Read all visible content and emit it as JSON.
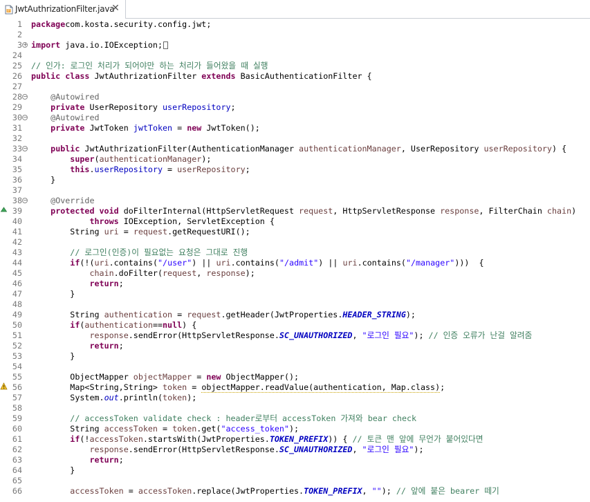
{
  "tab": {
    "title": "JwtAuthrizationFilter.java",
    "icon": "java-file-icon",
    "close": "✕"
  },
  "colors": {
    "keyword": "#7f0055",
    "comment": "#3f7f5f",
    "string": "#2a00ff",
    "field": "#0000c0",
    "parameter": "#6a3e3e",
    "annotation": "#646464",
    "line_number": "#787878"
  },
  "lines": [
    {
      "n": "1",
      "fold": "",
      "segs": [
        [
          "kw",
          "package"
        ],
        [
          "",
          "com.kosta.security.config.jwt;"
        ]
      ]
    },
    {
      "n": "2",
      "fold": "",
      "segs": []
    },
    {
      "n": "3",
      "fold": "+",
      "segs": [
        [
          "kw",
          "import"
        ],
        [
          "",
          " java.io.IOException;"
        ],
        [
          "box",
          ""
        ]
      ]
    },
    {
      "n": "24",
      "fold": "",
      "segs": []
    },
    {
      "n": "25",
      "fold": "",
      "segs": [
        [
          "cm",
          "// 인가: 로그인 처리가 되어야만 하는 처리가 들어왔을 때 실행"
        ]
      ]
    },
    {
      "n": "26",
      "fold": "",
      "segs": [
        [
          "kw",
          "public class"
        ],
        [
          "",
          " JwtAuthrizationFilter "
        ],
        [
          "kw",
          "extends"
        ],
        [
          "",
          " BasicAuthenticationFilter {"
        ]
      ]
    },
    {
      "n": "27",
      "fold": "",
      "segs": []
    },
    {
      "n": "28",
      "fold": "-",
      "segs": [
        [
          "",
          "    "
        ],
        [
          "ann",
          "@Autowired"
        ]
      ]
    },
    {
      "n": "29",
      "fold": "",
      "segs": [
        [
          "",
          "    "
        ],
        [
          "kw",
          "private"
        ],
        [
          "",
          " UserRepository "
        ],
        [
          "fld",
          "userRepository"
        ],
        [
          "",
          ";"
        ]
      ]
    },
    {
      "n": "30",
      "fold": "-",
      "segs": [
        [
          "",
          "    "
        ],
        [
          "ann",
          "@Autowired"
        ]
      ]
    },
    {
      "n": "31",
      "fold": "",
      "segs": [
        [
          "",
          "    "
        ],
        [
          "kw",
          "private"
        ],
        [
          "",
          " JwtToken "
        ],
        [
          "fld",
          "jwtToken"
        ],
        [
          "",
          " = "
        ],
        [
          "kw",
          "new"
        ],
        [
          "",
          " JwtToken();"
        ]
      ]
    },
    {
      "n": "32",
      "fold": "",
      "segs": []
    },
    {
      "n": "33",
      "fold": "-",
      "segs": [
        [
          "",
          "    "
        ],
        [
          "kw",
          "public"
        ],
        [
          "",
          " JwtAuthrizationFilter(AuthenticationManager "
        ],
        [
          "par",
          "authenticationManager"
        ],
        [
          "",
          ", UserRepository "
        ],
        [
          "par",
          "userRepository"
        ],
        [
          "",
          ") {"
        ]
      ]
    },
    {
      "n": "34",
      "fold": "",
      "segs": [
        [
          "",
          "        "
        ],
        [
          "kw",
          "super"
        ],
        [
          "",
          "("
        ],
        [
          "par",
          "authenticationManager"
        ],
        [
          "",
          ");"
        ]
      ]
    },
    {
      "n": "35",
      "fold": "",
      "segs": [
        [
          "",
          "        "
        ],
        [
          "kw",
          "this"
        ],
        [
          "",
          "."
        ],
        [
          "fld",
          "userRepository"
        ],
        [
          "",
          " = "
        ],
        [
          "par",
          "userRepository"
        ],
        [
          "",
          ";"
        ]
      ]
    },
    {
      "n": "36",
      "fold": "",
      "segs": [
        [
          "",
          "    }"
        ]
      ]
    },
    {
      "n": "37",
      "fold": "",
      "segs": []
    },
    {
      "n": "38",
      "fold": "-",
      "segs": [
        [
          "",
          "    "
        ],
        [
          "ann",
          "@Override"
        ]
      ]
    },
    {
      "n": "39",
      "fold": "",
      "segs": [
        [
          "",
          "    "
        ],
        [
          "kw",
          "protected void"
        ],
        [
          "",
          " doFilterInternal(HttpServletRequest "
        ],
        [
          "par",
          "request"
        ],
        [
          "",
          ", HttpServletResponse "
        ],
        [
          "par",
          "response"
        ],
        [
          "",
          ", FilterChain "
        ],
        [
          "par",
          "chain"
        ],
        [
          "",
          ")"
        ]
      ]
    },
    {
      "n": "40",
      "fold": "",
      "segs": [
        [
          "",
          "            "
        ],
        [
          "kw",
          "throws"
        ],
        [
          "",
          " IOException, ServletException {"
        ]
      ]
    },
    {
      "n": "41",
      "fold": "",
      "segs": [
        [
          "",
          "        String "
        ],
        [
          "par",
          "uri"
        ],
        [
          "",
          " = "
        ],
        [
          "par",
          "request"
        ],
        [
          "",
          ".getRequestURI();"
        ]
      ]
    },
    {
      "n": "42",
      "fold": "",
      "segs": []
    },
    {
      "n": "43",
      "fold": "",
      "segs": [
        [
          "",
          "        "
        ],
        [
          "cm",
          "// 로그인(인증)이 필요없는 요청은 그대로 진행"
        ]
      ]
    },
    {
      "n": "44",
      "fold": "",
      "segs": [
        [
          "",
          "        "
        ],
        [
          "kw",
          "if"
        ],
        [
          "",
          "(!("
        ],
        [
          "par",
          "uri"
        ],
        [
          "",
          ".contains("
        ],
        [
          "str",
          "\"/user\""
        ],
        [
          "",
          ") || "
        ],
        [
          "par",
          "uri"
        ],
        [
          "",
          ".contains("
        ],
        [
          "str",
          "\"/admit\""
        ],
        [
          "",
          ") || "
        ],
        [
          "par",
          "uri"
        ],
        [
          "",
          ".contains("
        ],
        [
          "str",
          "\"/manager\""
        ],
        [
          "",
          ")))  {"
        ]
      ]
    },
    {
      "n": "45",
      "fold": "",
      "segs": [
        [
          "",
          "            "
        ],
        [
          "par",
          "chain"
        ],
        [
          "",
          ".doFilter("
        ],
        [
          "par",
          "request"
        ],
        [
          "",
          ", "
        ],
        [
          "par",
          "response"
        ],
        [
          "",
          ");"
        ]
      ]
    },
    {
      "n": "46",
      "fold": "",
      "segs": [
        [
          "",
          "            "
        ],
        [
          "kw",
          "return"
        ],
        [
          "",
          ";"
        ]
      ]
    },
    {
      "n": "47",
      "fold": "",
      "segs": [
        [
          "",
          "        }"
        ]
      ]
    },
    {
      "n": "48",
      "fold": "",
      "segs": []
    },
    {
      "n": "49",
      "fold": "",
      "segs": [
        [
          "",
          "        String "
        ],
        [
          "par",
          "authentication"
        ],
        [
          "",
          " = "
        ],
        [
          "par",
          "request"
        ],
        [
          "",
          ".getHeader(JwtProperties."
        ],
        [
          "sfi",
          "HEADER_STRING"
        ],
        [
          "",
          ");"
        ]
      ]
    },
    {
      "n": "50",
      "fold": "",
      "segs": [
        [
          "",
          "        "
        ],
        [
          "kw",
          "if"
        ],
        [
          "",
          "("
        ],
        [
          "par",
          "authentication"
        ],
        [
          "",
          "=="
        ],
        [
          "kw",
          "null"
        ],
        [
          "",
          ") {"
        ]
      ]
    },
    {
      "n": "51",
      "fold": "",
      "segs": [
        [
          "",
          "            "
        ],
        [
          "par",
          "response"
        ],
        [
          "",
          ".sendError(HttpServletResponse."
        ],
        [
          "sfi",
          "SC_UNAUTHORIZED"
        ],
        [
          "",
          ", "
        ],
        [
          "str",
          "\"로그인 필요\""
        ],
        [
          "",
          "); "
        ],
        [
          "cm",
          "// 인증 오류가 난걸 알려줌"
        ]
      ]
    },
    {
      "n": "52",
      "fold": "",
      "segs": [
        [
          "",
          "            "
        ],
        [
          "kw",
          "return"
        ],
        [
          "",
          ";"
        ]
      ]
    },
    {
      "n": "53",
      "fold": "",
      "segs": [
        [
          "",
          "        }"
        ]
      ]
    },
    {
      "n": "54",
      "fold": "",
      "segs": []
    },
    {
      "n": "55",
      "fold": "",
      "segs": [
        [
          "",
          "        ObjectMapper "
        ],
        [
          "par",
          "objectMapper"
        ],
        [
          "",
          " = "
        ],
        [
          "kw",
          "new"
        ],
        [
          "",
          " ObjectMapper();"
        ]
      ]
    },
    {
      "n": "56",
      "fold": "",
      "segs": [
        [
          "",
          "        Map<String,String> "
        ],
        [
          "par",
          "token"
        ],
        [
          "",
          " = "
        ],
        [
          "warn",
          "objectMapper.readValue(authentication, Map.class)"
        ],
        [
          "",
          ";"
        ]
      ]
    },
    {
      "n": "57",
      "fold": "",
      "segs": [
        [
          "",
          "        System."
        ],
        [
          "sfn",
          "out"
        ],
        [
          "",
          ".println("
        ],
        [
          "par",
          "token"
        ],
        [
          "",
          ");"
        ]
      ]
    },
    {
      "n": "58",
      "fold": "",
      "segs": []
    },
    {
      "n": "59",
      "fold": "",
      "segs": [
        [
          "",
          "        "
        ],
        [
          "cm",
          "// accessToken validate check : header로부터 accessToken 가져와 bear check"
        ]
      ]
    },
    {
      "n": "60",
      "fold": "",
      "segs": [
        [
          "",
          "        String "
        ],
        [
          "par",
          "accessToken"
        ],
        [
          "",
          " = "
        ],
        [
          "par",
          "token"
        ],
        [
          "",
          ".get("
        ],
        [
          "str",
          "\"access_token\""
        ],
        [
          "",
          ");"
        ]
      ]
    },
    {
      "n": "61",
      "fold": "",
      "segs": [
        [
          "",
          "        "
        ],
        [
          "kw",
          "if"
        ],
        [
          "",
          "(!"
        ],
        [
          "par",
          "accessToken"
        ],
        [
          "",
          ".startsWith(JwtProperties."
        ],
        [
          "sfi",
          "TOKEN_PREFIX"
        ],
        [
          "",
          ")) { "
        ],
        [
          "cm",
          "// 토큰 맨 앞에 무언가 붙어있다면"
        ]
      ]
    },
    {
      "n": "62",
      "fold": "",
      "segs": [
        [
          "",
          "            "
        ],
        [
          "par",
          "response"
        ],
        [
          "",
          ".sendError(HttpServletResponse."
        ],
        [
          "sfi",
          "SC_UNAUTHORIZED"
        ],
        [
          "",
          ", "
        ],
        [
          "str",
          "\"로그인 필요\""
        ],
        [
          "",
          ");"
        ]
      ]
    },
    {
      "n": "63",
      "fold": "",
      "segs": [
        [
          "",
          "            "
        ],
        [
          "kw",
          "return"
        ],
        [
          "",
          ";"
        ]
      ]
    },
    {
      "n": "64",
      "fold": "",
      "segs": [
        [
          "",
          "        }"
        ]
      ]
    },
    {
      "n": "65",
      "fold": "",
      "segs": []
    },
    {
      "n": "66",
      "fold": "",
      "segs": [
        [
          "",
          "        "
        ],
        [
          "par",
          "accessToken"
        ],
        [
          "",
          " = "
        ],
        [
          "par",
          "accessToken"
        ],
        [
          "",
          ".replace(JwtProperties."
        ],
        [
          "sfi",
          "TOKEN_PREFIX"
        ],
        [
          "",
          ", "
        ],
        [
          "str",
          "\"\""
        ],
        [
          "",
          "); "
        ],
        [
          "cm",
          "// 앞에 붙은 bearer 떼기"
        ]
      ]
    }
  ]
}
